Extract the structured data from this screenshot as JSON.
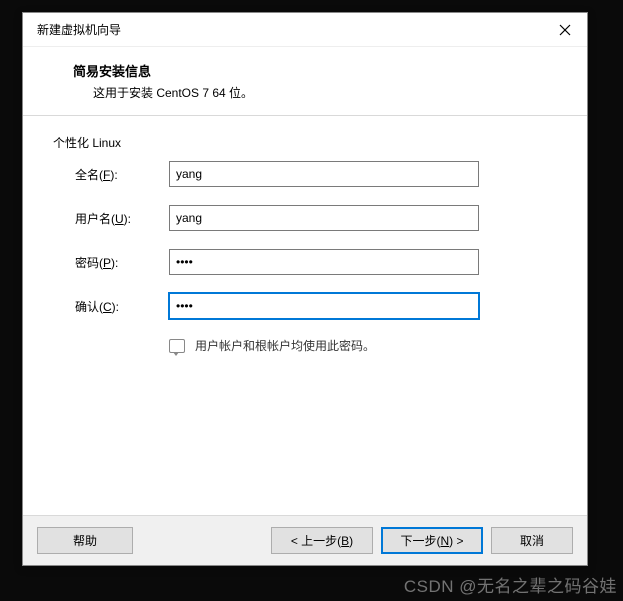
{
  "title": "新建虚拟机向导",
  "header": {
    "title": "简易安装信息",
    "subtitle": "这用于安装 CentOS 7 64 位。"
  },
  "section_label": "个性化 Linux",
  "fields": {
    "fullname": {
      "label": "全名(",
      "mnemonic": "F",
      "label_suffix": "):",
      "value": "yang"
    },
    "username": {
      "label": "用户名(",
      "mnemonic": "U",
      "label_suffix": "):",
      "value": "yang"
    },
    "password": {
      "label": "密码(",
      "mnemonic": "P",
      "label_suffix": "):",
      "value": "••••"
    },
    "confirm": {
      "label": "确认(",
      "mnemonic": "C",
      "label_suffix": "):",
      "value": "••••"
    }
  },
  "note": "用户帐户和根帐户均使用此密码。",
  "buttons": {
    "help": "帮助",
    "back_prefix": "< 上一步(",
    "back_mnemonic": "B",
    "back_suffix": ")",
    "next_prefix": "下一步(",
    "next_mnemonic": "N",
    "next_suffix": ") >",
    "cancel": "取消"
  },
  "watermark": "CSDN @无名之辈之码谷娃"
}
